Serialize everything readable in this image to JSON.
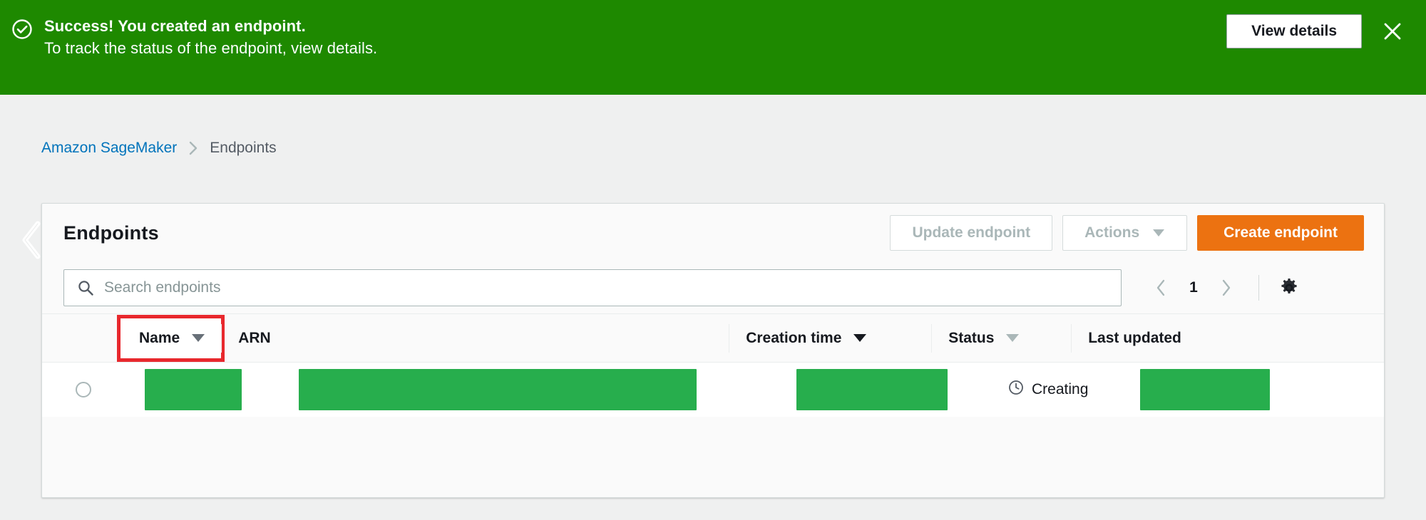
{
  "flash": {
    "icon": "check-circle-icon",
    "title": "Success! You created an endpoint.",
    "subtitle": "To track the status of the endpoint, view details.",
    "action_label": "View details",
    "close_label": "✕",
    "background": "#1e8900"
  },
  "breadcrumb": {
    "items": [
      {
        "label": "Amazon SageMaker",
        "current": false
      },
      {
        "label": "Endpoints",
        "current": true
      }
    ],
    "separator_icon": "chevron-right-icon",
    "link_color": "#0073bb"
  },
  "panel": {
    "title": "Endpoints",
    "collapse_icon": "chevron-left-icon",
    "buttons": {
      "update": "Update endpoint",
      "actions": "Actions",
      "actions_caret": "▼",
      "create": "Create endpoint",
      "create_color": "#ec7211"
    }
  },
  "search": {
    "icon": "search-icon",
    "placeholder": "Search endpoints",
    "value": ""
  },
  "pagination": {
    "prev_icon": "chevron-left-icon",
    "page": "1",
    "next_icon": "chevron-right-icon",
    "settings_icon": "gear-icon"
  },
  "table": {
    "columns": [
      {
        "label": "Name",
        "sortable": true,
        "caret": "▼",
        "sort_active": true,
        "highlighted": true
      },
      {
        "label": "ARN",
        "sortable": false,
        "caret": "",
        "sort_active": false,
        "highlighted": false
      },
      {
        "label": "Creation time",
        "sortable": true,
        "caret": "▼",
        "sort_active": true,
        "highlighted": false
      },
      {
        "label": "Status",
        "sortable": true,
        "caret": "▼",
        "sort_active": false,
        "highlighted": false
      },
      {
        "label": "Last updated",
        "sortable": false,
        "caret": "",
        "sort_active": false,
        "highlighted": false
      }
    ],
    "highlight_color": "#e8282d",
    "redaction_color": "#27ae4d",
    "rows": [
      {
        "selected": false,
        "name": "",
        "arn": "",
        "creation_time": "",
        "status": "Creating",
        "status_icon": "clock-icon",
        "last_updated": ""
      }
    ]
  }
}
